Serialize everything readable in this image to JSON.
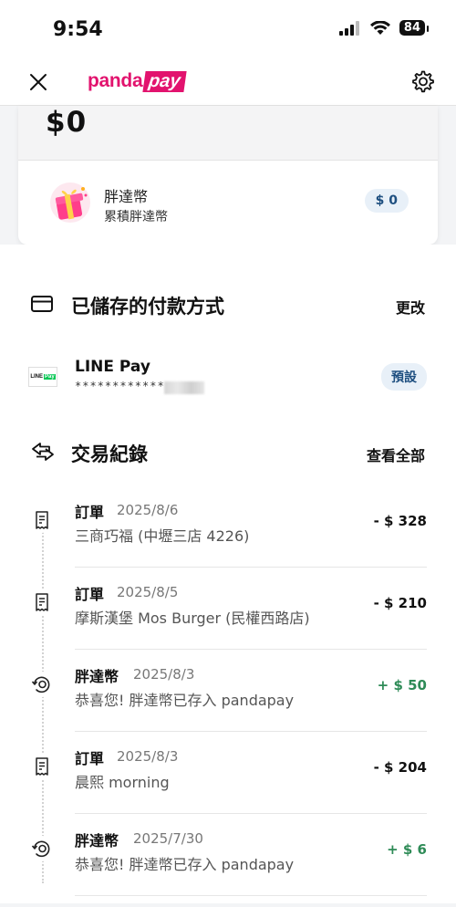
{
  "status_bar": {
    "time": "9:54",
    "battery": "84"
  },
  "header": {
    "logo_panda": "panda",
    "logo_pay": "pay",
    "brand_color": "#e2136e"
  },
  "balance": {
    "amount": "$0",
    "coins_title": "胖達幣",
    "coins_subtitle": "累積胖達幣",
    "coins_value": "$ 0"
  },
  "payment": {
    "title": "已儲存的付款方式",
    "edit_label": "更改",
    "method_name": "LINE Pay",
    "masked": "************",
    "default_label": "預設",
    "logo_line": "LINE",
    "logo_pay": "Pay"
  },
  "transactions": {
    "title": "交易紀錄",
    "view_all_label": "查看全部",
    "items": [
      {
        "type": "訂單",
        "date": "2025/8/6",
        "description": "三商巧福 (中壢三店 4226)",
        "amount": "- $ 328",
        "icon": "receipt-icon",
        "credit": false
      },
      {
        "type": "訂單",
        "date": "2025/8/5",
        "description": "摩斯漢堡 Mos Burger (民權西路店)",
        "amount": "- $ 210",
        "icon": "receipt-icon",
        "credit": false
      },
      {
        "type": "胖達幣",
        "date": "2025/8/3",
        "description": "恭喜您! 胖達幣已存入 pandapay",
        "amount": "+ $ 50",
        "icon": "coin-refresh-icon",
        "credit": true
      },
      {
        "type": "訂單",
        "date": "2025/8/3",
        "description": "晨熙 morning",
        "amount": "- $ 204",
        "icon": "receipt-icon",
        "credit": false
      },
      {
        "type": "胖達幣",
        "date": "2025/7/30",
        "description": "恭喜您! 胖達幣已存入 pandapay",
        "amount": "+ $ 6",
        "icon": "coin-refresh-icon",
        "credit": true
      }
    ]
  },
  "colors": {
    "credit": "#2e8b57",
    "pill_bg": "#e8f0f8",
    "pill_text": "#1e4f80"
  }
}
